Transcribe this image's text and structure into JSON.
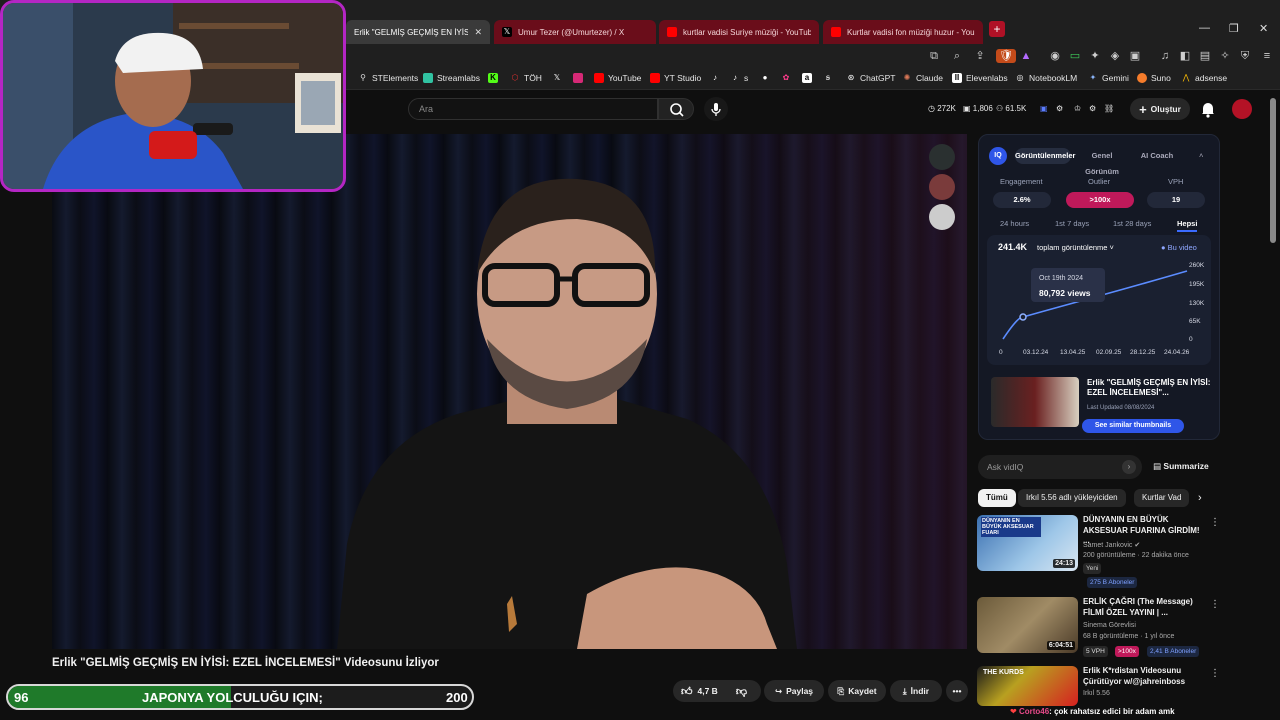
{
  "tabs": [
    {
      "label": "Erlik \"GELMİŞ GEÇMİŞ EN İYİSİ: E",
      "active": true
    },
    {
      "label": "Umur Tezer (@Umurtezer) / X"
    },
    {
      "label": "kurtlar vadisi Suriye müziği - YouTube"
    },
    {
      "label": "Kurtlar vadisi fon müziği huzur - You"
    }
  ],
  "bookmarks": [
    "STElements",
    "Streamlabs",
    "TÖH",
    "YouTube",
    "YT Studio",
    "s",
    "ChatGPT",
    "Claude",
    "Elevenlabs",
    "NotebookLM",
    "Gemini",
    "Suno",
    "adsense"
  ],
  "header": {
    "search_placeholder": "Ara",
    "stats": [
      "272K",
      "1,806",
      "61.5K"
    ],
    "create_label": "Oluştur"
  },
  "video": {
    "title": "Erlik \"GELMİŞ GEÇMİŞ EN İYİSİ: EZEL İNCELEMESİ\" Videosunu İzliyor",
    "likes": "4,7 B",
    "share": "Paylaş",
    "save": "Kaydet",
    "download": "İndir"
  },
  "overlay_bar": {
    "left_value": "96",
    "text": "JAPONYA YOLCULUĞU IÇIN;",
    "right_value": "200",
    "progress": 0.48,
    "fill_color": "#1f7a2a"
  },
  "vidiq": {
    "logo": "IQ",
    "tabs": [
      "Görüntülenmeler",
      "Genel Görünüm",
      "AI Coach"
    ],
    "metric_labels": [
      "Engagement",
      "Outlier",
      "VPH"
    ],
    "metric_values": [
      "2.6%",
      ">100x",
      "19"
    ],
    "ranges": [
      "24 hours",
      "1st 7 days",
      "1st 28 days",
      "Hepsi"
    ],
    "total": "241.4K",
    "total_label": "toplam görüntülenme",
    "legend": "Bu video",
    "tooltip_date": "Oct 19th 2024",
    "tooltip_value": "80,792 views",
    "y_ticks": [
      "260K",
      "195K",
      "130K",
      "65K",
      "0"
    ],
    "x_ticks": [
      "0",
      "03.12.24",
      "13.04.25",
      "02.09.25",
      "28.12.25",
      "24.04.26"
    ],
    "card_title": "Erlik \"GELMİŞ GEÇMİŞ EN İYİSİ: EZEL İNCELEMESİ\"...",
    "card_updated": "Last Updated 08/08/2024",
    "card_button": "See similar thumbnails",
    "ask_placeholder": "Ask vidIQ",
    "summarize": "Summarize"
  },
  "filters": [
    "Tümü",
    "Irkıl 5.56 adlı yükleyiciden",
    "Kurtlar Vad"
  ],
  "related": [
    {
      "title": "DÜNYANIN EN BÜYÜK AKSESUAR FUARINA GİRDİM! ...",
      "channel": "Samet Jankovic",
      "meta": "200 görüntüleme · 22 dakika önce",
      "duration": "24:13",
      "badge1": "Yeni",
      "badge2": "275 B Aboneler",
      "thumb_text": "DÜNYANIN EN BÜYÜK AKSESUAR FUARI"
    },
    {
      "title": "ERLİK ÇAĞRI (The Message) FİLMİ ÖZEL YAYINI | ...",
      "channel": "Sinema Görevlisi",
      "meta": "68 B görüntüleme · 1 yıl önce",
      "duration": "6:04:51",
      "badge1": "5 VPH",
      "badge_outlier": ">100x",
      "badge2": "2,41 B Aboneler"
    },
    {
      "title": "Erlik K*rdistan Videosunu Çürütüyor w/@jahreinboss",
      "channel": "Irkıl 5.56",
      "thumb_text": "THE KURDS"
    }
  ],
  "chat": {
    "user": "Corto46",
    "message": "çok rahatsız edici bir adam amk"
  }
}
